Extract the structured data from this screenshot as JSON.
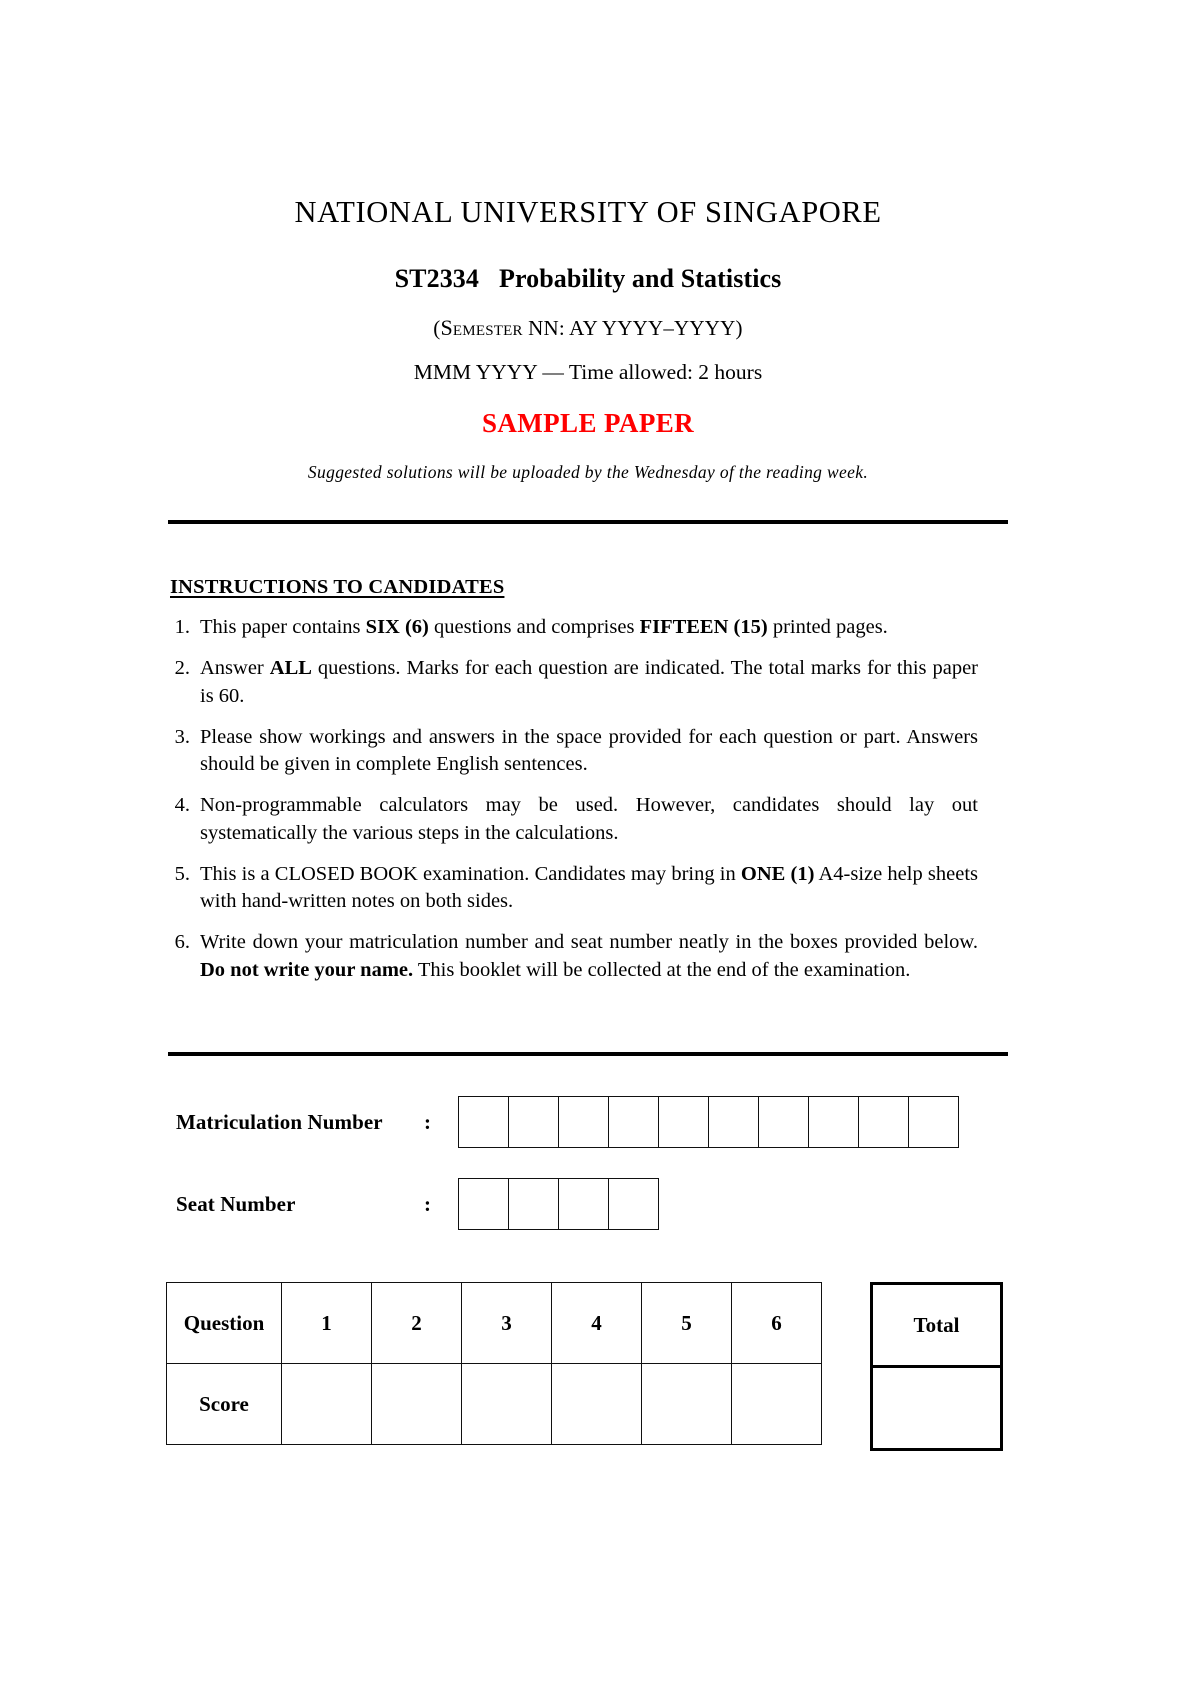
{
  "header": {
    "university": "NATIONAL UNIVERSITY OF SINGAPORE",
    "course_code": "ST2334",
    "course_name": "Probability and Statistics",
    "semester_open": "(",
    "semester_smallcaps": "Semester",
    "semester_rest": " NN: AY YYYY–YYYY)",
    "date_line": "MMM YYYY — Time allowed: 2 hours",
    "sample_paper": "SAMPLE PAPER",
    "sample_paper_color": "#FF0000",
    "solutions_note": "Suggested solutions will be uploaded by the Wednesday of the reading week."
  },
  "instructions": {
    "heading": "INSTRUCTIONS TO CANDIDATES",
    "items": [
      {
        "number": "1.",
        "parts": [
          {
            "text": "This paper contains ",
            "bold": false
          },
          {
            "text": "SIX (6)",
            "bold": true
          },
          {
            "text": " questions and comprises ",
            "bold": false
          },
          {
            "text": "FIFTEEN (15)",
            "bold": true
          },
          {
            "text": "  printed pages.",
            "bold": false
          }
        ]
      },
      {
        "number": "2.",
        "parts": [
          {
            "text": "Answer ",
            "bold": false
          },
          {
            "text": "ALL",
            "bold": true
          },
          {
            "text": " questions. Marks for each question are indicated. The total marks for this paper is 60.",
            "bold": false
          }
        ]
      },
      {
        "number": "3.",
        "parts": [
          {
            "text": "Please show workings and answers in the space provided for each question or part. Answers should be given in complete English sentences.",
            "bold": false
          }
        ]
      },
      {
        "number": "4.",
        "parts": [
          {
            "text": "Non-programmable calculators may be used.  However, candidates should lay out systematically the various steps in the calculations.",
            "bold": false
          }
        ]
      },
      {
        "number": "5.",
        "parts": [
          {
            "text": "This is a CLOSED BOOK examination. Candidates may bring in ",
            "bold": false
          },
          {
            "text": "ONE (1)",
            "bold": true
          },
          {
            "text": " A4-size help sheets with hand-written notes on both sides.",
            "bold": false
          }
        ]
      },
      {
        "number": "6.",
        "parts": [
          {
            "text": "Write down your matriculation number and seat number neatly in the boxes provided below. ",
            "bold": false
          },
          {
            "text": "Do not write your name.",
            "bold": true
          },
          {
            "text": " This booklet will be collected at the end of the examination.",
            "bold": false
          }
        ]
      }
    ]
  },
  "fields": {
    "matriculation_label": "Matriculation Number",
    "matriculation_colon": ":",
    "matriculation_box_count": 10,
    "matriculation_value": "",
    "seat_label": "Seat Number",
    "seat_colon": ":",
    "seat_box_count": 4,
    "seat_value": ""
  },
  "score_table": {
    "row_labels": [
      "Question",
      "Score"
    ],
    "questions": [
      "1",
      "2",
      "3",
      "4",
      "5",
      "6"
    ],
    "scores": [
      "",
      "",
      "",
      "",
      "",
      ""
    ],
    "total_label": "Total",
    "total_value": ""
  }
}
